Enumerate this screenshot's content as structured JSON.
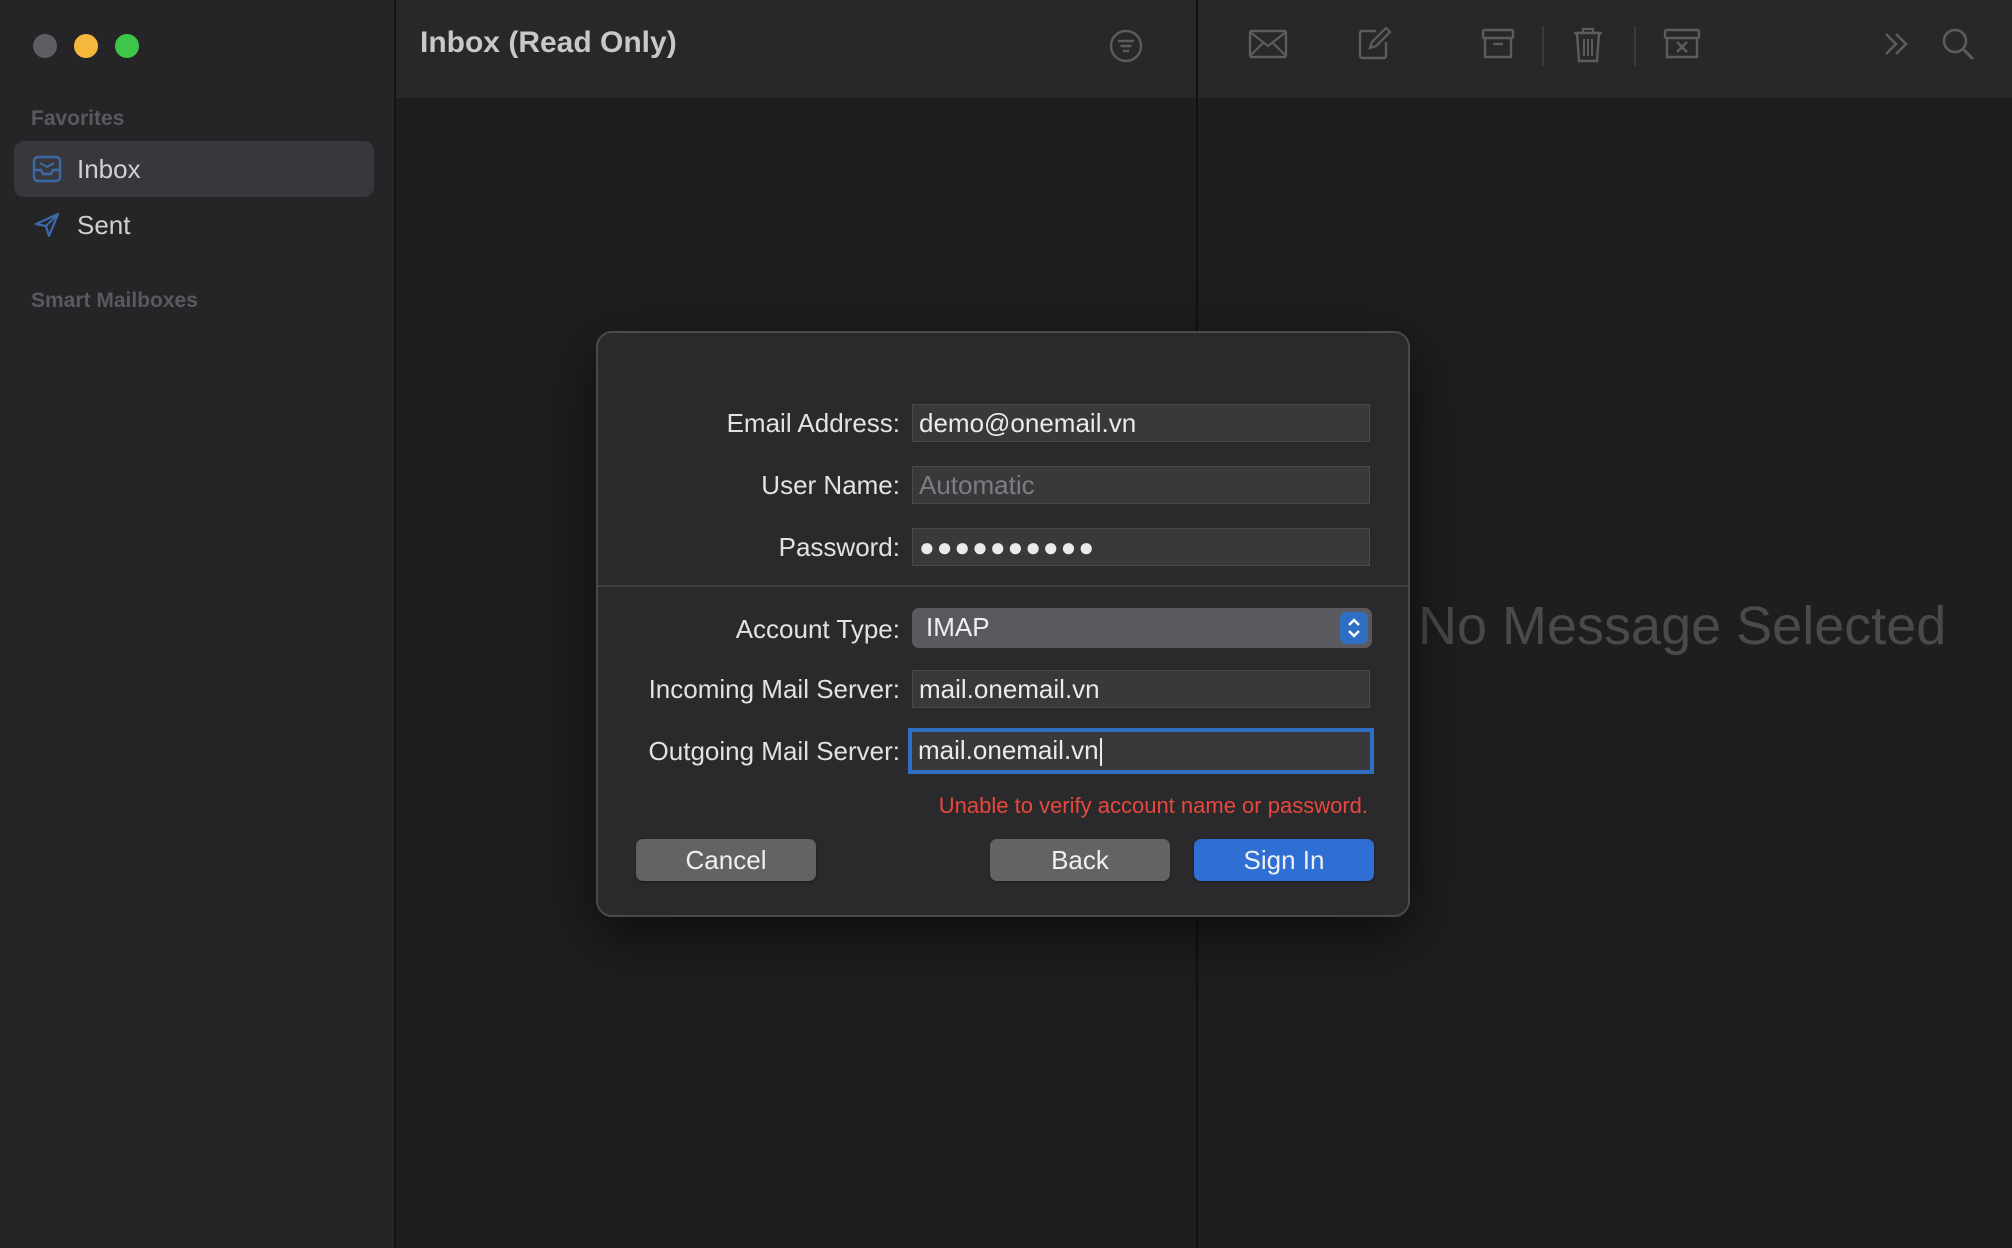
{
  "sidebar": {
    "favorites_label": "Favorites",
    "items": [
      {
        "label": "Inbox",
        "icon": "inbox-tray-icon"
      },
      {
        "label": "Sent",
        "icon": "paper-plane-icon"
      }
    ],
    "smart_mailboxes_label": "Smart Mailboxes"
  },
  "message_list": {
    "title": "Inbox (Read Only)"
  },
  "detail": {
    "placeholder": "No Message Selected",
    "toolbar_icons": [
      "envelope-icon",
      "compose-icon",
      "archive-icon",
      "trash-icon",
      "junk-icon",
      "more-chevrons-icon",
      "search-icon"
    ]
  },
  "dialog": {
    "email_label": "Email Address:",
    "email_value": "demo@onemail.vn",
    "username_label": "User Name:",
    "username_placeholder": "Automatic",
    "password_label": "Password:",
    "password_value": "●●●●●●●●●●",
    "account_type_label": "Account Type:",
    "account_type_value": "IMAP",
    "incoming_label": "Incoming Mail Server:",
    "incoming_value": "mail.onemail.vn",
    "outgoing_label": "Outgoing Mail Server:",
    "outgoing_value": "mail.onemail.vn",
    "error_text": "Unable to verify account name or password.",
    "cancel_label": "Cancel",
    "back_label": "Back",
    "signin_label": "Sign In"
  },
  "colors": {
    "accent": "#2f6fd4",
    "error": "#e9473d",
    "traffic_min": "#f5b83d",
    "traffic_max": "#3ec64a"
  }
}
